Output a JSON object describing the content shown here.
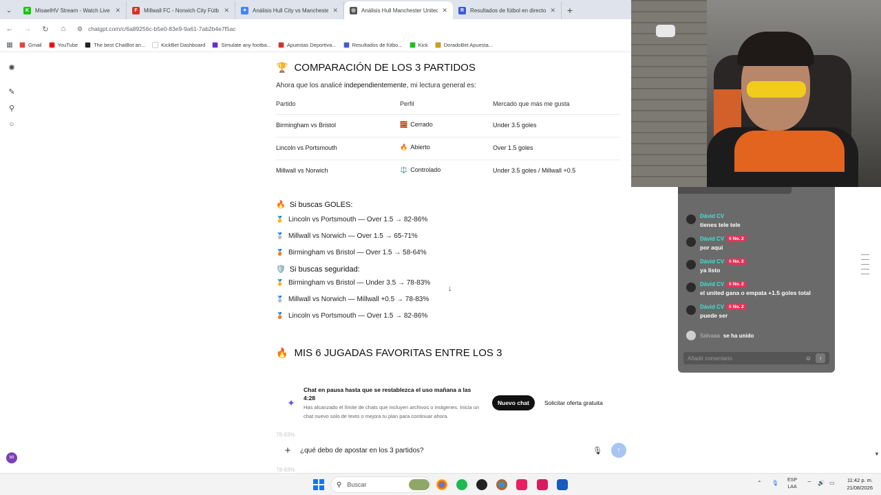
{
  "browser": {
    "tabs": [
      {
        "title": "MisaelHV Stream - Watch Live o",
        "icon_color": "#16c60c",
        "icon": "K",
        "active": false
      },
      {
        "title": "Millwall FC - Norwich City Fútb",
        "icon_color": "#d93025",
        "icon": "F",
        "active": false
      },
      {
        "title": "Análisis Hull City vs Mancheste",
        "icon_color": "#4285f4",
        "icon": "✦",
        "active": false
      },
      {
        "title": "Análisis Hull Manchester United",
        "icon_color": "#555555",
        "icon": "◎",
        "active": true
      },
      {
        "title": "Resultados de fútbol en directo",
        "icon_color": "#3b5bdb",
        "icon": "R",
        "active": false
      }
    ],
    "url": "chatgpt.com/c/6a89256c-b5e0-83e9-9a61-7ab2b4e7f5ac",
    "bookmarks": [
      {
        "label": "Gmail",
        "color": "#ea4335"
      },
      {
        "label": "YouTube",
        "color": "#ff0000"
      },
      {
        "label": "The best ChatBot an...",
        "color": "#222222"
      },
      {
        "label": "KickBet Dashboard",
        "color": "#ffffff"
      },
      {
        "label": "Simulate any footba...",
        "color": "#6d28d9"
      },
      {
        "label": "Apuestas Deportiva...",
        "color": "#d93025"
      },
      {
        "label": "Resultados de fútbo...",
        "color": "#3b5bdb"
      },
      {
        "label": "Kick",
        "color": "#16c60c"
      },
      {
        "label": "DoradoBet Apuesta...",
        "color": "#d4a017"
      }
    ]
  },
  "rail": {
    "avatar": "MI"
  },
  "content": {
    "comparison": {
      "emoji": "🏆",
      "title": "COMPARACIÓN DE LOS 3 PARTIDOS",
      "intro_prefix": "Ahora que los analicé ",
      "intro_bold": "independientemente",
      "intro_suffix": ", mi lectura general es:",
      "headers": [
        "Partido",
        "Perfil",
        "Mercado que más me gusta"
      ],
      "rows": [
        {
          "match": "Birmingham vs Bristol",
          "profile_icon": "🧱",
          "profile": "Cerrado",
          "market": "Under 3.5 goles"
        },
        {
          "match": "Lincoln vs Portsmouth",
          "profile_icon": "🔥",
          "profile": "Abierto",
          "market": "Over 1.5 goles"
        },
        {
          "match": "Millwall vs Norwich",
          "profile_icon": "⚖️",
          "profile": "Controlado",
          "market": "Under 3.5 goles / Millwall +0.5"
        }
      ]
    },
    "goals": {
      "emoji": "🔥",
      "title": "Si buscas GOLES:",
      "items": [
        {
          "medal": "🥇",
          "text": "Lincoln vs Portsmouth — Over 1.5 → 82-86%"
        },
        {
          "medal": "🥈",
          "text": "Millwall vs Norwich — Over 1.5 → 65-71%"
        },
        {
          "medal": "🥉",
          "text": "Birmingham vs Bristol — Over 1.5 → 58-64%"
        }
      ]
    },
    "safety": {
      "emoji": "🛡️",
      "title": "Si buscas seguridad:",
      "items": [
        {
          "medal": "🥇",
          "text": "Birmingham vs Bristol — Under 3.5 → 78-83%"
        },
        {
          "medal": "🥈",
          "text": "Millwall vs Norwich — Millwall +0.5 → 78-83%"
        },
        {
          "medal": "🥉",
          "text": "Lincoln vs Portsmouth — Over 1.5 → 82-86%"
        }
      ]
    },
    "favorites": {
      "emoji": "🔥",
      "title": "MIS 6 JUGADAS FAVORITAS ENTRE LOS 3"
    },
    "faded_1": "78-83%",
    "faded_2": "78-83%"
  },
  "banner": {
    "title": "Chat en pausa hasta que se restablezca el uso mañana a las 4:28",
    "body": "Has alcanzado el límite de chats que incluyen archivos o imágenes. Inicia un chat nuevo solo de texto o mejora tu plan para continuar ahora.",
    "new_chat": "Nuevo chat",
    "offer": "Solicitar oferta gratuita"
  },
  "composer": {
    "value": "¿qué debo de apostar en los 3 partidos?"
  },
  "stream_chat": {
    "messages": [
      {
        "user": "Dávid CV",
        "badge": false,
        "text": "tienes tele tele"
      },
      {
        "user": "Dávid CV",
        "badge": true,
        "badge_label": "No. 2",
        "text": "por aqui"
      },
      {
        "user": "Dávid CV",
        "badge": true,
        "badge_label": "No. 2",
        "text": "ya listo"
      },
      {
        "user": "Dávid CV",
        "badge": true,
        "badge_label": "No. 2",
        "text": "el united gana o empata +1.5 goles total"
      },
      {
        "user": "Dávid CV",
        "badge": true,
        "badge_label": "No. 2",
        "text": "puede ser"
      }
    ],
    "badge_num": "6",
    "join_user": "Salvaaa",
    "join_text": "se ha unido",
    "input_placeholder": "Añadir comentario"
  },
  "taskbar": {
    "search_placeholder": "Buscar",
    "lang_1": "ESP",
    "lang_2": "LAA",
    "time": "11:42 p. m.",
    "date": "21/08/2026"
  }
}
